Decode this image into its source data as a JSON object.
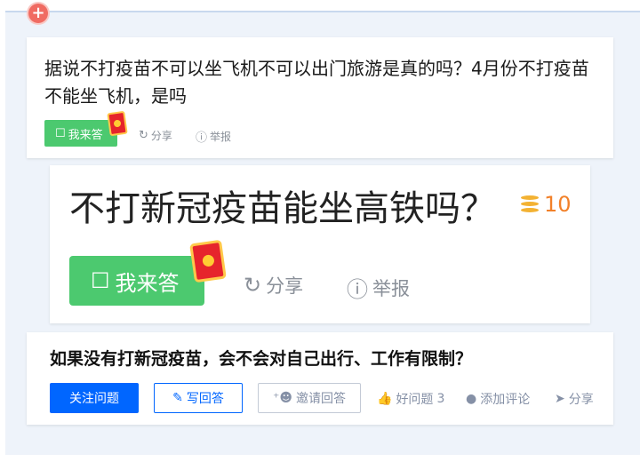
{
  "question_list": {
    "item1": {
      "title": "据说不打疫苗不可以坐飞机不可以出门旅游是真的吗？4月份不打疫苗不能坐飞机，是吗",
      "answer_label": "我来答",
      "share_label": "分享",
      "report_label": "举报"
    }
  },
  "zoom_view": {
    "title": "不打新冠疫苗能坐高铁吗？",
    "reward_value": "10",
    "answer_label": "我来答",
    "share_label": "分享",
    "report_label": "举报"
  },
  "question_card": {
    "title": "如果没有打新冠疫苗，会不会对自己出行、工作有限制？",
    "follow_label": "关注问题",
    "write_label": "写回答",
    "invite_label": "邀请回答",
    "good_question_label": "好问题",
    "good_question_count": "3",
    "comment_label": "添加评论",
    "share_label": "分享"
  },
  "colors": {
    "answer_green": "#4cc96f",
    "primary_blue": "#0066ff",
    "coin_orange": "#f2812a",
    "redpack_red": "#e6242c"
  },
  "icons": [
    "plus-icon",
    "edit-icon",
    "red-packet-icon",
    "share-icon",
    "report-icon",
    "coin-icon",
    "pencil-icon",
    "invite-icon",
    "thumbs-up-icon",
    "comment-icon",
    "send-icon"
  ]
}
